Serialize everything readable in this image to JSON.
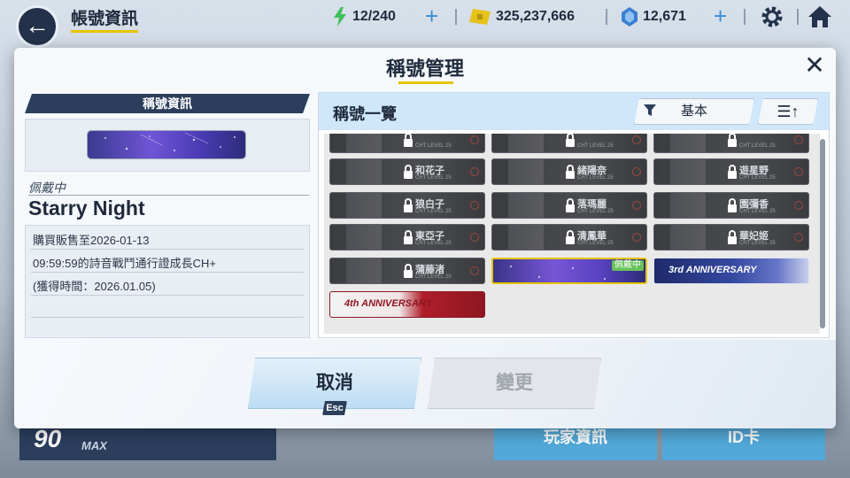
{
  "topbar": {
    "title": "帳號資訊",
    "stamina": "12/240",
    "coins": "325,237,666",
    "gems": "12,671"
  },
  "modal": {
    "title": "稱號管理"
  },
  "left": {
    "header": "稱號資訊",
    "equipped_label": "佩戴中",
    "equipped_title": "Starry Night",
    "info": {
      "line1": "購買販售至2026-01-13",
      "line2": "09:59:59的詩音戰鬥通行證成長CH+",
      "line3": "(獲得時間：2026.01.05)"
    }
  },
  "right": {
    "header": "稱號一覽",
    "filter_label": "基本",
    "sort_label": "☰↑",
    "tiles": [
      {
        "name": "",
        "locked": true
      },
      {
        "name": "",
        "locked": true
      },
      {
        "name": "",
        "locked": true
      },
      {
        "name": "和花子",
        "locked": true
      },
      {
        "name": "緒陽奈",
        "locked": true
      },
      {
        "name": "遊星野",
        "locked": true
      },
      {
        "name": "狼白子",
        "locked": true
      },
      {
        "name": "落瑪麗",
        "locked": true
      },
      {
        "name": "園彌香",
        "locked": true
      },
      {
        "name": "東亞子",
        "locked": true
      },
      {
        "name": "清鳳華",
        "locked": true
      },
      {
        "name": "華妃姬",
        "locked": true
      },
      {
        "name": "蒲藤渚",
        "locked": true
      },
      {
        "name": "",
        "equipped": true
      },
      {
        "name": "3rd ANNIVERSARY"
      },
      {
        "name": "4th ANNIVERSARY"
      }
    ],
    "equipped_badge": "佩戴中",
    "tile_sub": "CHT LEVEL 25"
  },
  "buttons": {
    "cancel": "取消",
    "esc": "Esc",
    "change": "變更"
  },
  "background": {
    "level": "90",
    "max": "MAX",
    "player_info": "玩家資訊",
    "id_card": "ID卡"
  }
}
